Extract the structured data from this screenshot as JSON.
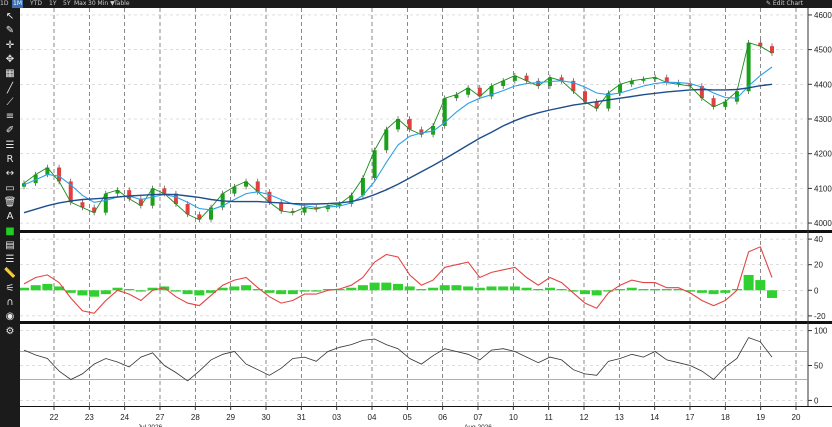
{
  "toolbar_top": {
    "ranges": [
      "1D",
      "1M",
      "YTD",
      "1Y",
      "5Y",
      "Max",
      "30 Min ▼",
      "Table"
    ],
    "active_range": "1M",
    "edit_chart": "✎ Edit Chart"
  },
  "tools": [
    "arrow-icon",
    "pencil-icon",
    "crosshair-icon",
    "move-icon",
    "grid-icon",
    "line-icon",
    "ray-icon",
    "channel-icon",
    "brush-icon",
    "fib-icon",
    "text-r-icon",
    "measure-icon",
    "eraser-icon",
    "trash-icon",
    "text-a-icon",
    "color-square-icon",
    "bars-icon",
    "lines-icon",
    "ruler-icon",
    "sliders-icon",
    "magnet-icon",
    "circle-icon",
    "gear-icon"
  ],
  "colors": {
    "price": "#1a8a1a",
    "sma_fast": "#2aa1e6",
    "sma_slow": "#1f4e8c",
    "osc_line": "#e34545",
    "osc_pos": "#2fd12f",
    "rsi": "#333333",
    "overbought": "#e06060",
    "oversold": "#4cc94c",
    "tool_color": "#22cc22"
  },
  "chart_data": [
    {
      "type": "line",
      "panel": "price",
      "ylim": [
        3980,
        4620
      ],
      "y_ticks": [
        "4000",
        "4100",
        "4200",
        "4300",
        "4400",
        "4500",
        "4600"
      ],
      "series": [
        {
          "values": [
            4115,
            4140,
            4160,
            4120,
            4060,
            4045,
            4030,
            4085,
            4095,
            4070,
            4050,
            4100,
            4085,
            4055,
            4025,
            4010,
            4045,
            4085,
            4105,
            4120,
            4090,
            4060,
            4035,
            4030,
            4045,
            4040,
            4050,
            4055,
            4080,
            4130,
            4210,
            4270,
            4300,
            4270,
            4255,
            4280,
            4360,
            4370,
            4390,
            4365,
            4395,
            4410,
            4425,
            4410,
            4395,
            4420,
            4410,
            4380,
            4350,
            4330,
            4375,
            4400,
            4410,
            4415,
            4420,
            4405,
            4400,
            4395,
            4360,
            4335,
            4350,
            4380,
            4520,
            4510,
            4490
          ]
        },
        {
          "values": [
            4110,
            4125,
            4140,
            4135,
            4110,
            4080,
            4060,
            4065,
            4075,
            4078,
            4068,
            4075,
            4082,
            4075,
            4060,
            4042,
            4038,
            4050,
            4068,
            4085,
            4090,
            4082,
            4068,
            4055,
            4050,
            4045,
            4046,
            4049,
            4058,
            4080,
            4120,
            4175,
            4225,
            4250,
            4260,
            4265,
            4290,
            4320,
            4345,
            4360,
            4370,
            4382,
            4395,
            4402,
            4405,
            4408,
            4410,
            4405,
            4392,
            4375,
            4370,
            4375,
            4385,
            4395,
            4402,
            4406,
            4405,
            4402,
            4392,
            4375,
            4362,
            4360,
            4395,
            4425,
            4450
          ]
        },
        {
          "values": [
            4030,
            4040,
            4050,
            4058,
            4064,
            4068,
            4070,
            4072,
            4075,
            4078,
            4080,
            4082,
            4083,
            4082,
            4078,
            4074,
            4068,
            4064,
            4062,
            4062,
            4062,
            4060,
            4058,
            4056,
            4055,
            4055,
            4056,
            4058,
            4062,
            4070,
            4082,
            4096,
            4112,
            4130,
            4148,
            4166,
            4185,
            4205,
            4225,
            4245,
            4262,
            4280,
            4295,
            4308,
            4318,
            4326,
            4333,
            4340,
            4345,
            4350,
            4355,
            4360,
            4365,
            4370,
            4374,
            4378,
            4381,
            4384,
            4385,
            4384,
            4384,
            4385,
            4390,
            4396,
            4400
          ]
        }
      ]
    },
    {
      "type": "line",
      "panel": "oscillator",
      "ylim": [
        -24,
        44
      ],
      "y_ticks": [
        "40",
        "20",
        "0",
        "-20"
      ],
      "series": [
        {
          "values": [
            5,
            10,
            12,
            6,
            -6,
            -16,
            -18,
            -8,
            0,
            -3,
            -8,
            0,
            2,
            -5,
            -10,
            -12,
            -4,
            4,
            8,
            10,
            2,
            -5,
            -10,
            -8,
            -3,
            -3,
            0,
            1,
            4,
            10,
            22,
            28,
            26,
            12,
            4,
            8,
            18,
            20,
            22,
            10,
            14,
            16,
            18,
            10,
            4,
            10,
            6,
            -2,
            -10,
            -14,
            -2,
            4,
            8,
            6,
            6,
            2,
            2,
            -2,
            -8,
            -12,
            -8,
            0,
            30,
            34,
            10
          ]
        },
        {
          "values": [
            2,
            4,
            5,
            3,
            -2,
            -4,
            -5,
            -3,
            2,
            1,
            -1,
            2,
            3,
            -1,
            -3,
            -4,
            -2,
            2,
            3,
            4,
            1,
            -2,
            -3,
            -3,
            -1,
            -1,
            1,
            1,
            2,
            4,
            6,
            6,
            5,
            3,
            1,
            2,
            4,
            4,
            3,
            2,
            3,
            3,
            3,
            2,
            1,
            2,
            1,
            -1,
            -3,
            -4,
            -1,
            1,
            2,
            1,
            1,
            1,
            1,
            -1,
            -2,
            -3,
            -2,
            1,
            12,
            8,
            -6
          ]
        }
      ]
    },
    {
      "type": "line",
      "panel": "rsi",
      "ylim": [
        -8,
        108
      ],
      "y_ticks": [
        "100",
        "50",
        "0"
      ],
      "levels": {
        "overbought": 70,
        "oversold": 30
      },
      "series": [
        {
          "values": [
            72,
            65,
            60,
            42,
            30,
            38,
            52,
            60,
            55,
            48,
            62,
            68,
            50,
            40,
            28,
            42,
            58,
            66,
            70,
            52,
            44,
            36,
            46,
            60,
            62,
            56,
            70,
            76,
            80,
            86,
            88,
            80,
            74,
            60,
            52,
            64,
            74,
            70,
            66,
            58,
            72,
            74,
            70,
            62,
            54,
            62,
            58,
            44,
            38,
            36,
            56,
            60,
            66,
            62,
            70,
            58,
            54,
            50,
            42,
            30,
            48,
            60,
            90,
            84,
            62
          ]
        }
      ]
    },
    {
      "type": "line",
      "panel": "x_axis",
      "x_ticks": [
        "22",
        "23",
        "24",
        "27",
        "28",
        "29",
        "30",
        "31",
        "03",
        "04",
        "05",
        "06",
        "07",
        "10",
        "11",
        "12",
        "13",
        "14",
        "17",
        "18",
        "19",
        "20"
      ],
      "month_labels": [
        "Jul 2026",
        "Aug 2026"
      ]
    }
  ]
}
